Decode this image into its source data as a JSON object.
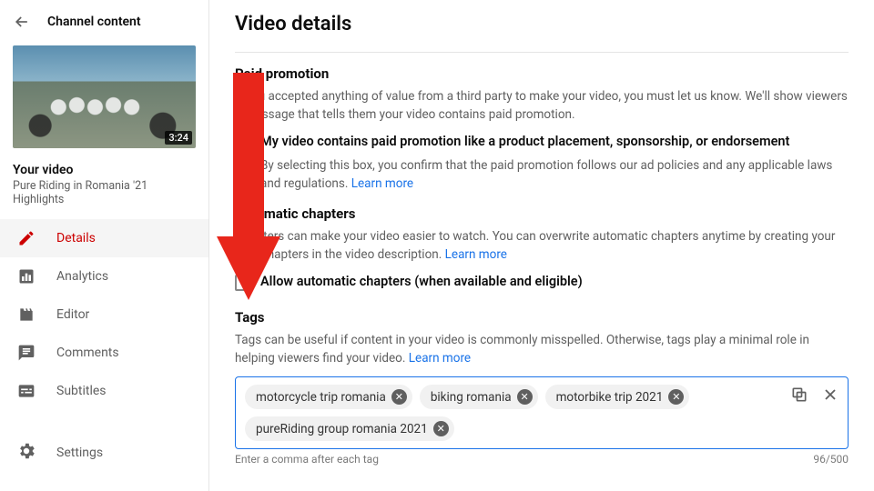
{
  "sidebar": {
    "header": "Channel content",
    "duration": "3:24",
    "your_video_label": "Your video",
    "video_title": "Pure Riding in Romania '21 Highlights",
    "nav": [
      {
        "label": "Details",
        "icon": "pencil",
        "active": true
      },
      {
        "label": "Analytics",
        "icon": "bars",
        "active": false
      },
      {
        "label": "Editor",
        "icon": "film",
        "active": false
      },
      {
        "label": "Comments",
        "icon": "comment",
        "active": false
      },
      {
        "label": "Subtitles",
        "icon": "subtitles",
        "active": false
      }
    ],
    "settings_label": "Settings"
  },
  "main": {
    "title": "Video details",
    "paid": {
      "heading": "Paid promotion",
      "desc": "If you accepted anything of value from a third party to make your video, you must let us know. We'll show viewers a message that tells them your video contains paid promotion.",
      "checkbox_label": "My video contains paid promotion like a product placement, sponsorship, or endorsement",
      "subtext": "By selecting this box, you confirm that the paid promotion follows our ad policies and any applicable laws and regulations. ",
      "learn_more": "Learn more"
    },
    "chapters": {
      "heading": "Automatic chapters",
      "desc_a": "Chapters can make your video easier to watch. You can overwrite automatic chapters anytime by creating your own chapters in the video description. ",
      "learn_more": "Learn more",
      "checkbox_label": "Allow automatic chapters (when available and eligible)"
    },
    "tags": {
      "heading": "Tags",
      "desc_a": "Tags can be useful if content in your video is commonly misspelled. Otherwise, tags play a minimal role in helping viewers find your video. ",
      "learn_more": "Learn more",
      "chips": [
        "motorcycle trip romania",
        "biking romania",
        "motorbike trip 2021",
        "pureRiding group romania 2021"
      ],
      "hint": "Enter a comma after each tag",
      "counter": "96/500"
    }
  }
}
